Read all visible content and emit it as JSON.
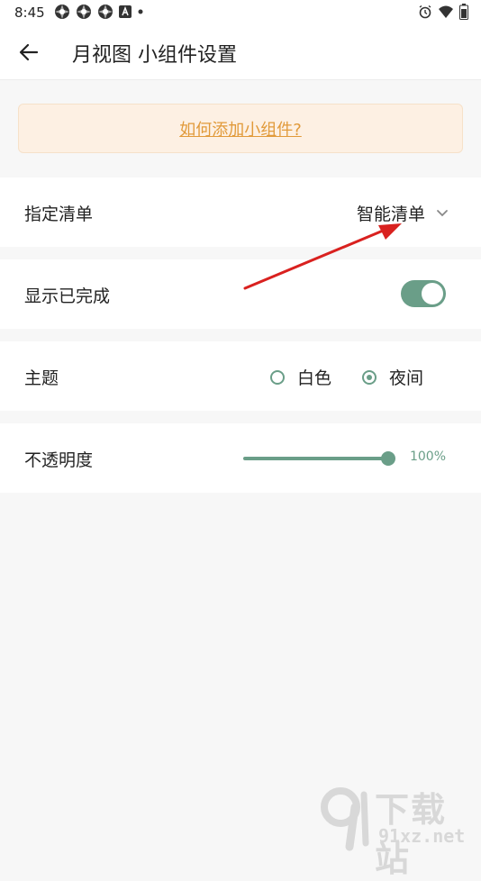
{
  "status_bar": {
    "time": "8:45",
    "left_icons": [
      "aperture-icon",
      "aperture-icon",
      "aperture-icon",
      "font-a-icon",
      "dot-icon"
    ],
    "right_icons": [
      "alarm-icon",
      "wifi-icon",
      "battery-icon"
    ]
  },
  "app_bar": {
    "title": "月视图 小组件设置",
    "back_icon": "arrow-left-icon"
  },
  "help_banner": {
    "link_text": "如何添加小组件?"
  },
  "settings": {
    "list": {
      "label": "指定清单",
      "value": "智能清单"
    },
    "show_completed": {
      "label": "显示已完成",
      "enabled": true
    },
    "theme": {
      "label": "主题",
      "options": [
        {
          "label": "白色",
          "selected": false
        },
        {
          "label": "夜间",
          "selected": true
        }
      ]
    },
    "opacity": {
      "label": "不透明度",
      "value_text": "100%",
      "value": 100
    }
  },
  "watermark": {
    "top_text": "下载站",
    "bottom_text": "91xz.net"
  },
  "colors": {
    "accent": "#6a9e88",
    "banner_bg": "#fdf0e3",
    "link": "#e19a3a",
    "annotation_arrow": "#d9211f"
  }
}
